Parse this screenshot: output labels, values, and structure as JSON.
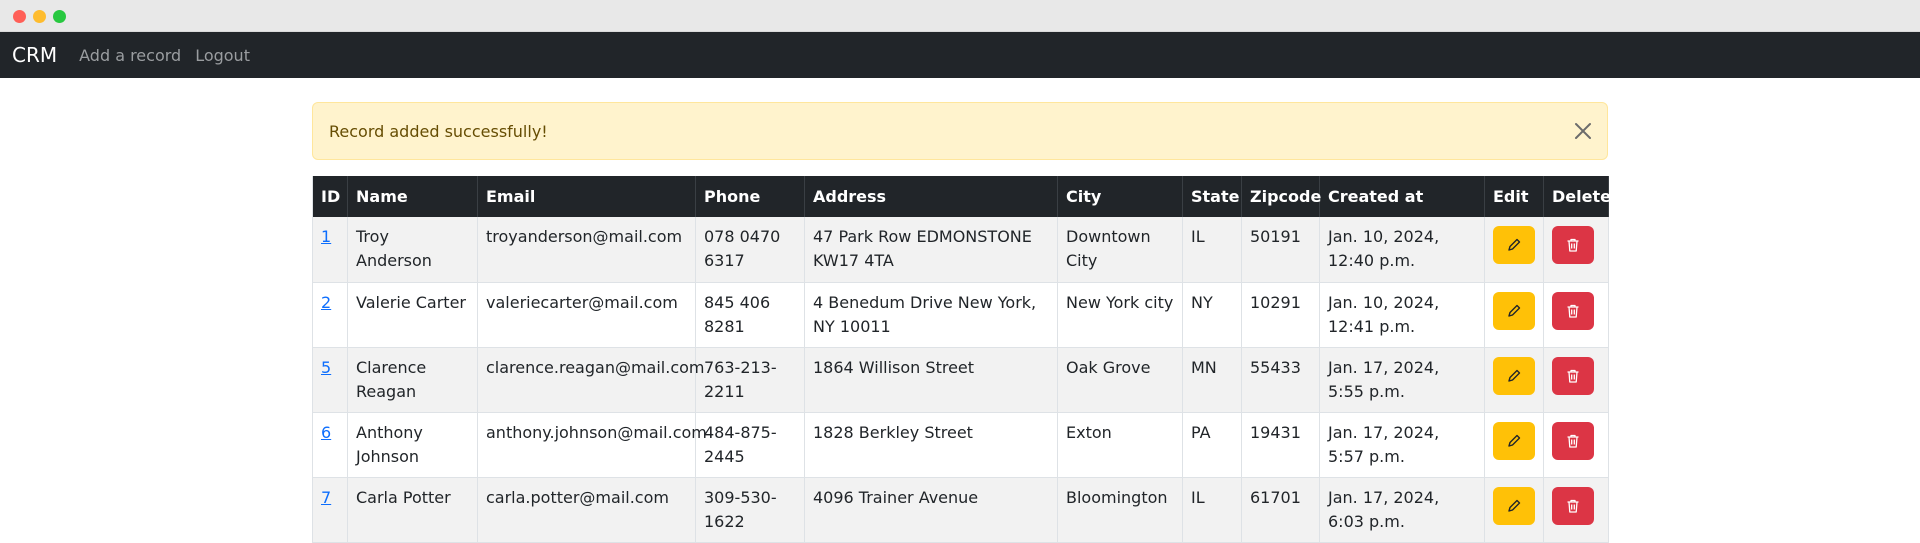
{
  "window": {
    "controls": [
      "close",
      "minimize",
      "maximize"
    ]
  },
  "navbar": {
    "brand": "CRM",
    "links": [
      "Add a record",
      "Logout"
    ]
  },
  "alert": {
    "message": "Record added successfully!",
    "close_icon": "close-icon"
  },
  "table": {
    "headers": [
      "ID",
      "Name",
      "Email",
      "Phone",
      "Address",
      "City",
      "State",
      "Zipcode",
      "Created at",
      "Edit",
      "Delete"
    ],
    "rows": [
      {
        "id": "1",
        "name": "Troy Anderson",
        "email": "troyanderson@mail.com",
        "phone": "078 0470 6317",
        "address": "47 Park Row EDMONSTONE KW17 4TA",
        "city": "Downtown City",
        "state": "IL",
        "zipcode": "50191",
        "created": "Jan. 10, 2024, 12:40 p.m."
      },
      {
        "id": "2",
        "name": "Valerie Carter",
        "email": "valeriecarter@mail.com",
        "phone": "845 406 8281",
        "address": "4 Benedum Drive New York, NY 10011",
        "city": "New York city",
        "state": "NY",
        "zipcode": "10291",
        "created": "Jan. 10, 2024, 12:41 p.m."
      },
      {
        "id": "5",
        "name": "Clarence Reagan",
        "email": "clarence.reagan@mail.com",
        "phone": "763-213-2211",
        "address": "1864 Willison Street",
        "city": "Oak Grove",
        "state": "MN",
        "zipcode": "55433",
        "created": "Jan. 17, 2024, 5:55 p.m."
      },
      {
        "id": "6",
        "name": "Anthony Johnson",
        "email": "anthony.johnson@mail.com",
        "phone": "484-875-2445",
        "address": "1828 Berkley Street",
        "city": "Exton",
        "state": "PA",
        "zipcode": "19431",
        "created": "Jan. 17, 2024, 5:57 p.m."
      },
      {
        "id": "7",
        "name": "Carla Potter",
        "email": "carla.potter@mail.com",
        "phone": "309-530-1622",
        "address": "4096 Trainer Avenue",
        "city": "Bloomington",
        "state": "IL",
        "zipcode": "61701",
        "created": "Jan. 17, 2024, 6:03 p.m."
      }
    ],
    "edit_icon": "pencil-icon",
    "delete_icon": "trash-icon"
  },
  "colors": {
    "navbar_bg": "#212529",
    "alert_bg": "#fff3cd",
    "alert_text": "#664d03",
    "edit_button": "#ffc107",
    "delete_button": "#dc3545",
    "link": "#0d6efd"
  }
}
